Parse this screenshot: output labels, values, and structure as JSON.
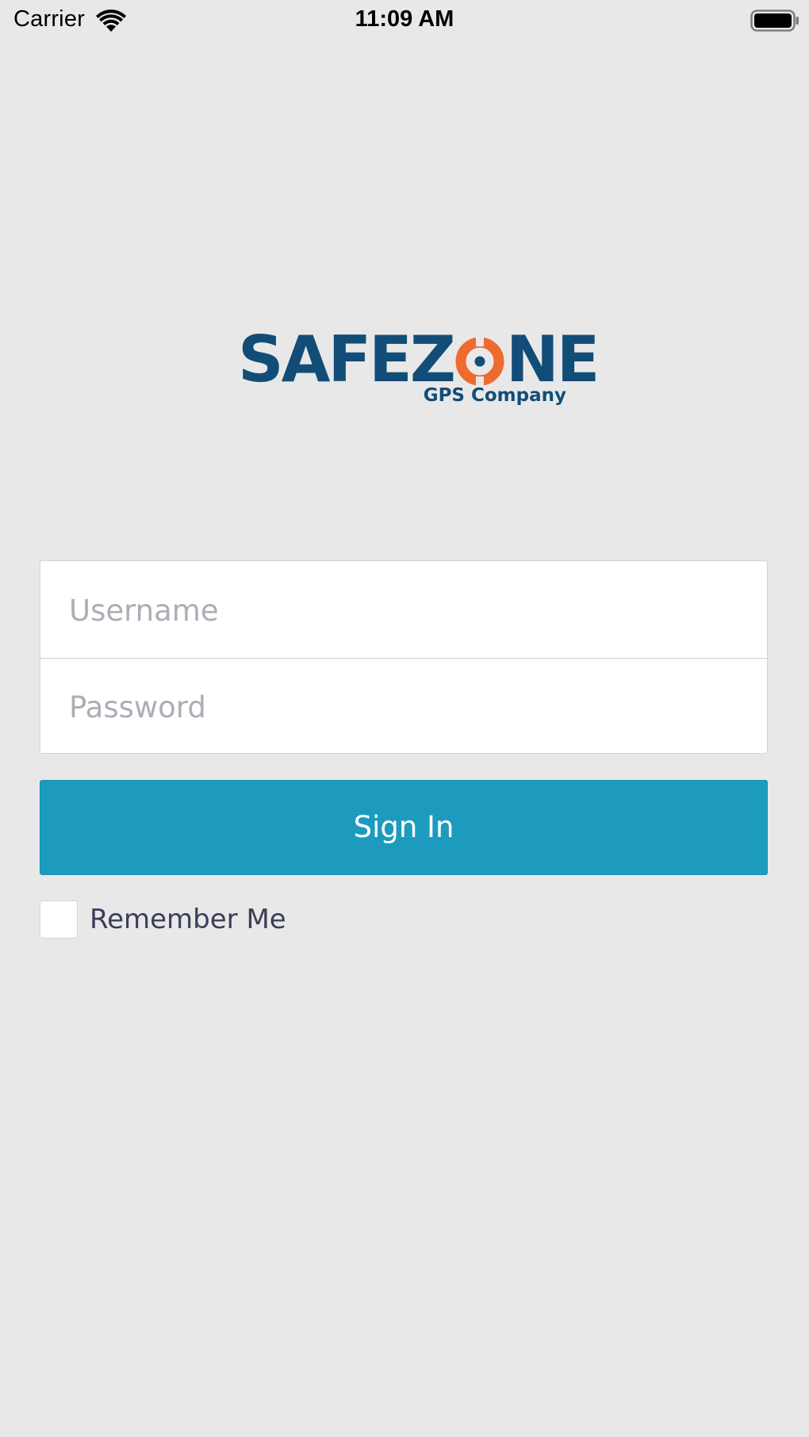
{
  "status_bar": {
    "carrier": "Carrier",
    "time": "11:09 AM",
    "wifi_icon": "wifi-icon",
    "battery_icon": "battery-icon"
  },
  "logo": {
    "word_part1": "SAFEZ",
    "word_part2": "NE",
    "tagline": "GPS Company",
    "brand_color": "#124d78",
    "accent_color": "#ee6b2f"
  },
  "login_form": {
    "username_placeholder": "Username",
    "username_value": "",
    "password_placeholder": "Password",
    "password_value": "",
    "sign_in_label": "Sign In",
    "button_color": "#1c9bbf",
    "remember_me_label": "Remember Me",
    "remember_me_checked": false
  },
  "colors": {
    "background": "#e8e8e9",
    "placeholder_text": "#adadb6",
    "label_text": "#3b3d5a"
  }
}
